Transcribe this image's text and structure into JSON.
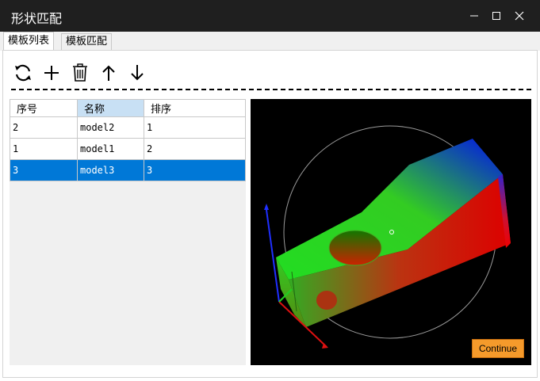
{
  "window": {
    "title": "形状匹配",
    "controls": [
      "minimize",
      "maximize",
      "close"
    ]
  },
  "tabs": [
    {
      "label": "模板列表",
      "active": true
    },
    {
      "label": "模板匹配",
      "active": false
    }
  ],
  "toolbar": {
    "buttons": [
      {
        "name": "refresh",
        "icon": "refresh-icon"
      },
      {
        "name": "add",
        "icon": "plus-icon"
      },
      {
        "name": "delete",
        "icon": "trash-icon"
      },
      {
        "name": "move-up",
        "icon": "arrow-up-icon"
      },
      {
        "name": "move-down",
        "icon": "arrow-down-icon"
      }
    ]
  },
  "table": {
    "headers": [
      "序号",
      "名称",
      "排序"
    ],
    "rows": [
      [
        "2",
        "model2",
        "1"
      ],
      [
        "1",
        "model1",
        "2"
      ],
      [
        "3",
        "model3",
        "3"
      ]
    ],
    "selected_row": 2
  },
  "viewport": {
    "background": "#000000",
    "continue_label": "Continue"
  },
  "colors": {
    "selection": "#0078d7",
    "header_highlight": "#c8e0f4",
    "continue_button": "#f59a2b",
    "titlebar": "#1f1f1f"
  }
}
